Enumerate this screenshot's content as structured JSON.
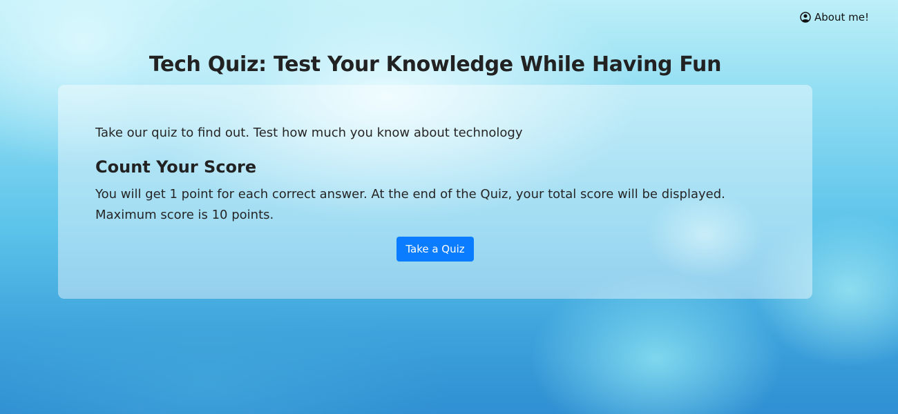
{
  "nav": {
    "about_label": "About me!",
    "about_icon": "user-circle-icon"
  },
  "header": {
    "title": "Tech Quiz: Test Your Knowledge While Having Fun"
  },
  "card": {
    "intro": "Take our quiz to find out. Test how much you know about technology",
    "score_heading": "Count Your Score",
    "score_description": "You will get 1 point for each correct answer. At the end of the Quiz, your total score will be displayed. Maximum score is 10 points.",
    "button_label": "Take a Quiz"
  },
  "colors": {
    "button": "#0a7cff",
    "card_background": "rgba(255,255,255,0.42)"
  }
}
